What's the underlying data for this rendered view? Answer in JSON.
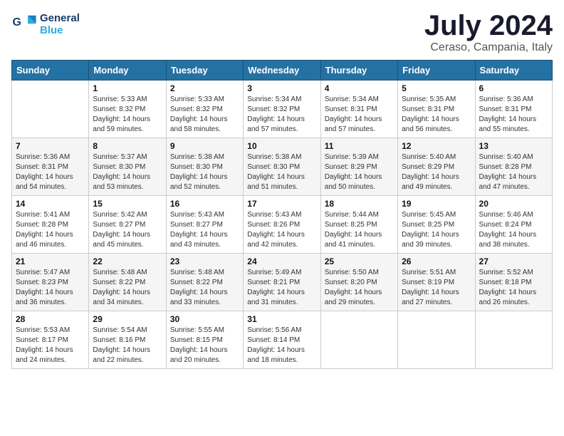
{
  "logo": {
    "line1": "General",
    "line2": "Blue"
  },
  "title": "July 2024",
  "subtitle": "Ceraso, Campania, Italy",
  "days_header": [
    "Sunday",
    "Monday",
    "Tuesday",
    "Wednesday",
    "Thursday",
    "Friday",
    "Saturday"
  ],
  "weeks": [
    [
      {
        "day": "",
        "info": ""
      },
      {
        "day": "1",
        "info": "Sunrise: 5:33 AM\nSunset: 8:32 PM\nDaylight: 14 hours\nand 59 minutes."
      },
      {
        "day": "2",
        "info": "Sunrise: 5:33 AM\nSunset: 8:32 PM\nDaylight: 14 hours\nand 58 minutes."
      },
      {
        "day": "3",
        "info": "Sunrise: 5:34 AM\nSunset: 8:32 PM\nDaylight: 14 hours\nand 57 minutes."
      },
      {
        "day": "4",
        "info": "Sunrise: 5:34 AM\nSunset: 8:31 PM\nDaylight: 14 hours\nand 57 minutes."
      },
      {
        "day": "5",
        "info": "Sunrise: 5:35 AM\nSunset: 8:31 PM\nDaylight: 14 hours\nand 56 minutes."
      },
      {
        "day": "6",
        "info": "Sunrise: 5:36 AM\nSunset: 8:31 PM\nDaylight: 14 hours\nand 55 minutes."
      }
    ],
    [
      {
        "day": "7",
        "info": "Sunrise: 5:36 AM\nSunset: 8:31 PM\nDaylight: 14 hours\nand 54 minutes."
      },
      {
        "day": "8",
        "info": "Sunrise: 5:37 AM\nSunset: 8:30 PM\nDaylight: 14 hours\nand 53 minutes."
      },
      {
        "day": "9",
        "info": "Sunrise: 5:38 AM\nSunset: 8:30 PM\nDaylight: 14 hours\nand 52 minutes."
      },
      {
        "day": "10",
        "info": "Sunrise: 5:38 AM\nSunset: 8:30 PM\nDaylight: 14 hours\nand 51 minutes."
      },
      {
        "day": "11",
        "info": "Sunrise: 5:39 AM\nSunset: 8:29 PM\nDaylight: 14 hours\nand 50 minutes."
      },
      {
        "day": "12",
        "info": "Sunrise: 5:40 AM\nSunset: 8:29 PM\nDaylight: 14 hours\nand 49 minutes."
      },
      {
        "day": "13",
        "info": "Sunrise: 5:40 AM\nSunset: 8:28 PM\nDaylight: 14 hours\nand 47 minutes."
      }
    ],
    [
      {
        "day": "14",
        "info": "Sunrise: 5:41 AM\nSunset: 8:28 PM\nDaylight: 14 hours\nand 46 minutes."
      },
      {
        "day": "15",
        "info": "Sunrise: 5:42 AM\nSunset: 8:27 PM\nDaylight: 14 hours\nand 45 minutes."
      },
      {
        "day": "16",
        "info": "Sunrise: 5:43 AM\nSunset: 8:27 PM\nDaylight: 14 hours\nand 43 minutes."
      },
      {
        "day": "17",
        "info": "Sunrise: 5:43 AM\nSunset: 8:26 PM\nDaylight: 14 hours\nand 42 minutes."
      },
      {
        "day": "18",
        "info": "Sunrise: 5:44 AM\nSunset: 8:25 PM\nDaylight: 14 hours\nand 41 minutes."
      },
      {
        "day": "19",
        "info": "Sunrise: 5:45 AM\nSunset: 8:25 PM\nDaylight: 14 hours\nand 39 minutes."
      },
      {
        "day": "20",
        "info": "Sunrise: 5:46 AM\nSunset: 8:24 PM\nDaylight: 14 hours\nand 38 minutes."
      }
    ],
    [
      {
        "day": "21",
        "info": "Sunrise: 5:47 AM\nSunset: 8:23 PM\nDaylight: 14 hours\nand 36 minutes."
      },
      {
        "day": "22",
        "info": "Sunrise: 5:48 AM\nSunset: 8:22 PM\nDaylight: 14 hours\nand 34 minutes."
      },
      {
        "day": "23",
        "info": "Sunrise: 5:48 AM\nSunset: 8:22 PM\nDaylight: 14 hours\nand 33 minutes."
      },
      {
        "day": "24",
        "info": "Sunrise: 5:49 AM\nSunset: 8:21 PM\nDaylight: 14 hours\nand 31 minutes."
      },
      {
        "day": "25",
        "info": "Sunrise: 5:50 AM\nSunset: 8:20 PM\nDaylight: 14 hours\nand 29 minutes."
      },
      {
        "day": "26",
        "info": "Sunrise: 5:51 AM\nSunset: 8:19 PM\nDaylight: 14 hours\nand 27 minutes."
      },
      {
        "day": "27",
        "info": "Sunrise: 5:52 AM\nSunset: 8:18 PM\nDaylight: 14 hours\nand 26 minutes."
      }
    ],
    [
      {
        "day": "28",
        "info": "Sunrise: 5:53 AM\nSunset: 8:17 PM\nDaylight: 14 hours\nand 24 minutes."
      },
      {
        "day": "29",
        "info": "Sunrise: 5:54 AM\nSunset: 8:16 PM\nDaylight: 14 hours\nand 22 minutes."
      },
      {
        "day": "30",
        "info": "Sunrise: 5:55 AM\nSunset: 8:15 PM\nDaylight: 14 hours\nand 20 minutes."
      },
      {
        "day": "31",
        "info": "Sunrise: 5:56 AM\nSunset: 8:14 PM\nDaylight: 14 hours\nand 18 minutes."
      },
      {
        "day": "",
        "info": ""
      },
      {
        "day": "",
        "info": ""
      },
      {
        "day": "",
        "info": ""
      }
    ]
  ]
}
